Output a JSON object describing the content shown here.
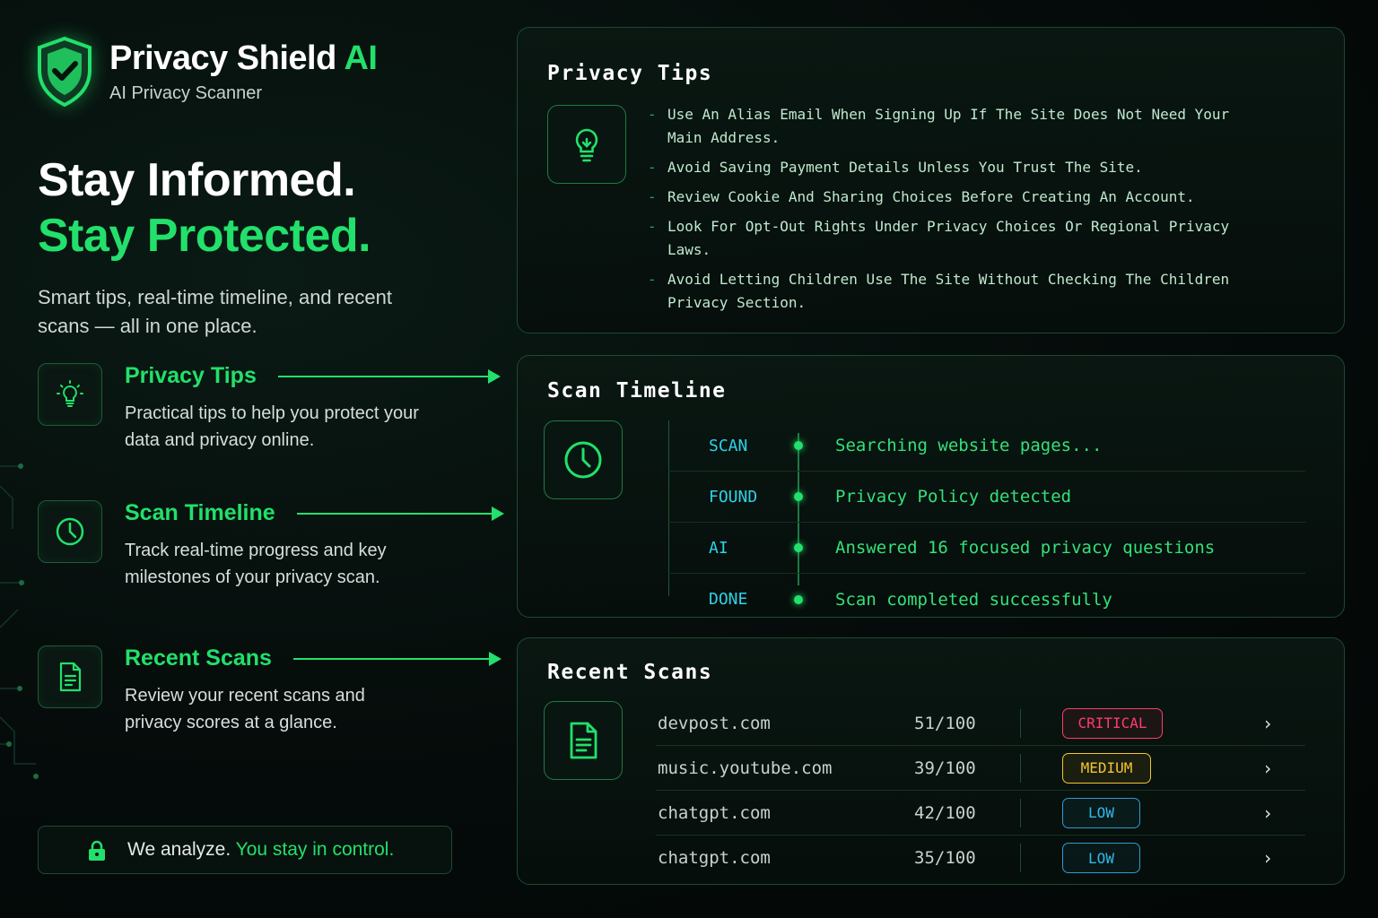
{
  "brand": {
    "name": "Privacy Shield",
    "name_accent": "AI",
    "subtitle": "AI Privacy Scanner"
  },
  "hero": {
    "line1": "Stay Informed.",
    "line2": "Stay Protected.",
    "description": "Smart tips, real-time timeline, and recent scans — all in one place."
  },
  "features": [
    {
      "icon": "lightbulb-icon",
      "title": "Privacy Tips",
      "description": "Practical tips to help you protect your data and privacy online."
    },
    {
      "icon": "clock-icon",
      "title": "Scan Timeline",
      "description": "Track real-time progress and key milestones of your privacy scan."
    },
    {
      "icon": "document-icon",
      "title": "Recent Scans",
      "description": "Review your recent scans and privacy scores at a glance."
    }
  ],
  "footer": {
    "icon": "lock-icon",
    "text": "We analyze.",
    "accent": "You stay in control."
  },
  "privacy_tips": {
    "title": "Privacy Tips",
    "icon": "lightbulb-icon",
    "items": [
      "Use An Alias Email When Signing Up If The Site Does Not Need Your Main Address.",
      "Avoid Saving Payment Details Unless You Trust The Site.",
      "Review Cookie And Sharing Choices Before Creating An Account.",
      "Look For Opt-Out Rights Under Privacy Choices Or Regional Privacy Laws.",
      "Avoid Letting Children Use The Site Without Checking The Children Privacy Section."
    ]
  },
  "scan_timeline": {
    "title": "Scan Timeline",
    "icon": "clock-icon",
    "events": [
      {
        "tag": "SCAN",
        "message": "Searching website pages..."
      },
      {
        "tag": "FOUND",
        "message": "Privacy Policy detected"
      },
      {
        "tag": "AI",
        "message": "Answered 16 focused privacy questions"
      },
      {
        "tag": "DONE",
        "message": "Scan completed successfully"
      }
    ]
  },
  "recent_scans": {
    "title": "Recent Scans",
    "icon": "document-icon",
    "rows": [
      {
        "domain": "devpost.com",
        "score": "51/100",
        "risk": "CRITICAL",
        "level": "critical"
      },
      {
        "domain": "music.youtube.com",
        "score": "39/100",
        "risk": "MEDIUM",
        "level": "medium"
      },
      {
        "domain": "chatgpt.com",
        "score": "42/100",
        "risk": "LOW",
        "level": "low"
      },
      {
        "domain": "chatgpt.com",
        "score": "35/100",
        "risk": "LOW",
        "level": "low"
      }
    ]
  },
  "colors": {
    "accent": "#22e06b",
    "critical": "#ff3b6b",
    "medium": "#f5c431",
    "low": "#33b8ea",
    "timeline_tag": "#2cd3e8"
  }
}
